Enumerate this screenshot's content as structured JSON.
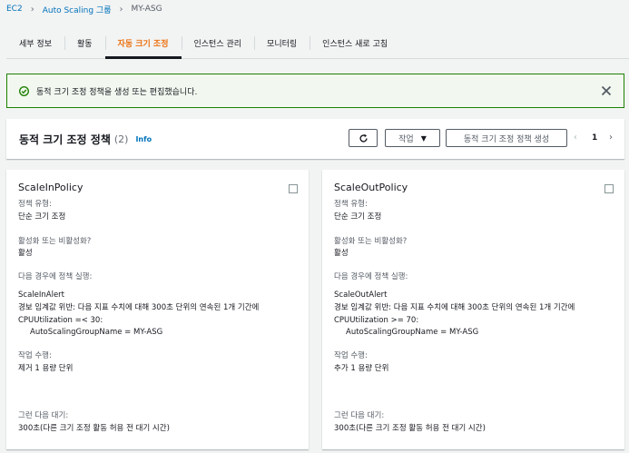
{
  "breadcrumb": {
    "items": [
      "EC2",
      "Auto Scaling 그룹"
    ],
    "current": "MY-ASG"
  },
  "tabs": [
    {
      "label": "세부 정보",
      "active": false
    },
    {
      "label": "활동",
      "active": false
    },
    {
      "label": "자동 크기 조정",
      "active": true
    },
    {
      "label": "인스턴스 관리",
      "active": false
    },
    {
      "label": "모니터링",
      "active": false
    },
    {
      "label": "인스턴스 새로 고침",
      "active": false
    }
  ],
  "flash": {
    "message": "동적 크기 조정 정책을 생성 또는 편집했습니다.",
    "icon": "check-circle-icon",
    "color": "#1d8102"
  },
  "panel": {
    "title": "동적 크기 조정 정책",
    "count": "(2)",
    "info": "Info",
    "actions_label": "작업",
    "create_label": "동적 크기 조정 정책 생성",
    "page": "1"
  },
  "policies": [
    {
      "name": "ScaleInPolicy",
      "type_label": "정책 유형:",
      "type_value": "단순 크기 조정",
      "enabled_label": "활성화 또는 비활성화?",
      "enabled_value": "활성",
      "trigger_label": "다음 경우에 정책 실행:",
      "alarm_name": "ScaleInAlert",
      "alarm_desc": "경보 임계값 위반: 다음 지표 수치에 대해 300초 단위의 연속된 1개 기간에",
      "condition": "CPUUtilization =< 30:",
      "dimension": "AutoScalingGroupName = MY-ASG",
      "action_label": "작업 수행:",
      "action_value": "제거 1 용량 단위",
      "wait_label": "그런 다음 대기:",
      "wait_value": "300초(다른 크기 조정 활동 허용 전 대기 시간)"
    },
    {
      "name": "ScaleOutPolicy",
      "type_label": "정책 유형:",
      "type_value": "단순 크기 조정",
      "enabled_label": "활성화 또는 비활성화?",
      "enabled_value": "활성",
      "trigger_label": "다음 경우에 정책 실행:",
      "alarm_name": "ScaleOutAlert",
      "alarm_desc": "경보 임계값 위반: 다음 지표 수치에 대해 300초 단위의 연속된 1개 기간에",
      "condition": "CPUUtilization >= 70:",
      "dimension": "AutoScalingGroupName = MY-ASG",
      "action_label": "작업 수행:",
      "action_value": "추가 1 용량 단위",
      "wait_label": "그런 다음 대기:",
      "wait_value": "300초(다른 크기 조정 활동 허용 전 대기 시간)"
    }
  ],
  "colors": {
    "accent": "#ec7211",
    "link": "#0073bb",
    "success": "#1d8102"
  }
}
